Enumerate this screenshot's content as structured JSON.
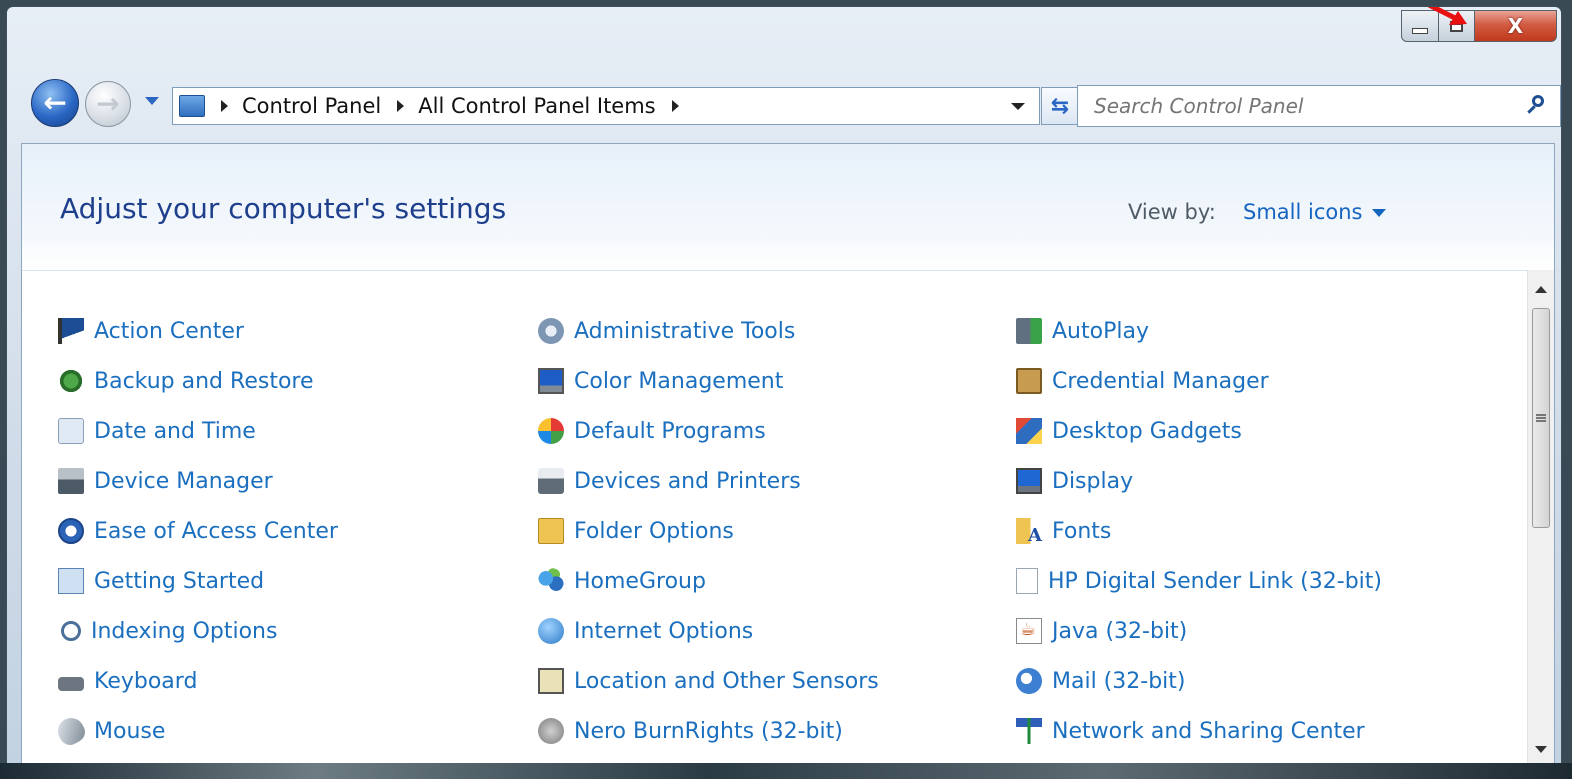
{
  "window": {
    "caption": {
      "minimize_icon": "minimize-icon",
      "maximize_icon": "restore-icon",
      "close_label": "X",
      "close_color": "#c83a1e"
    },
    "annotation_arrow_color": "#e81010"
  },
  "navbar": {
    "back_icon": "back-arrow-icon",
    "forward_icon": "forward-arrow-icon",
    "breadcrumb": [
      "Control Panel",
      "All Control Panel Items"
    ],
    "search": {
      "placeholder": "Search Control Panel",
      "value": ""
    }
  },
  "main": {
    "title": "Adjust your computer's settings",
    "view_by_label": "View by:",
    "view_by_value": "Small icons",
    "accent_color": "#1b6fbf",
    "items": [
      {
        "label": "Action Center",
        "icon": "flag-icon"
      },
      {
        "label": "Backup and Restore",
        "icon": "backup-icon"
      },
      {
        "label": "Date and Time",
        "icon": "clock-icon"
      },
      {
        "label": "Device Manager",
        "icon": "device-manager-icon"
      },
      {
        "label": "Ease of Access Center",
        "icon": "accessibility-icon"
      },
      {
        "label": "Getting Started",
        "icon": "getting-started-icon"
      },
      {
        "label": "Indexing Options",
        "icon": "indexing-icon"
      },
      {
        "label": "Keyboard",
        "icon": "keyboard-icon"
      },
      {
        "label": "Mouse",
        "icon": "mouse-icon"
      },
      {
        "label": "Administrative Tools",
        "icon": "admin-tools-icon"
      },
      {
        "label": "Color Management",
        "icon": "color-monitor-icon"
      },
      {
        "label": "Default Programs",
        "icon": "default-programs-icon"
      },
      {
        "label": "Devices and Printers",
        "icon": "printer-icon"
      },
      {
        "label": "Folder Options",
        "icon": "folder-icon"
      },
      {
        "label": "HomeGroup",
        "icon": "homegroup-icon"
      },
      {
        "label": "Internet Options",
        "icon": "globe-icon"
      },
      {
        "label": "Location and Other Sensors",
        "icon": "sensor-icon"
      },
      {
        "label": "Nero BurnRights (32-bit)",
        "icon": "nero-icon"
      },
      {
        "label": "AutoPlay",
        "icon": "autoplay-icon"
      },
      {
        "label": "Credential Manager",
        "icon": "credential-icon"
      },
      {
        "label": "Desktop Gadgets",
        "icon": "gadgets-icon"
      },
      {
        "label": "Display",
        "icon": "display-icon"
      },
      {
        "label": "Fonts",
        "icon": "fonts-icon"
      },
      {
        "label": "HP Digital Sender Link (32-bit)",
        "icon": "blank-document-icon"
      },
      {
        "label": "Java (32-bit)",
        "icon": "java-icon"
      },
      {
        "label": "Mail (32-bit)",
        "icon": "mail-icon"
      },
      {
        "label": "Network and Sharing Center",
        "icon": "network-icon"
      }
    ]
  }
}
